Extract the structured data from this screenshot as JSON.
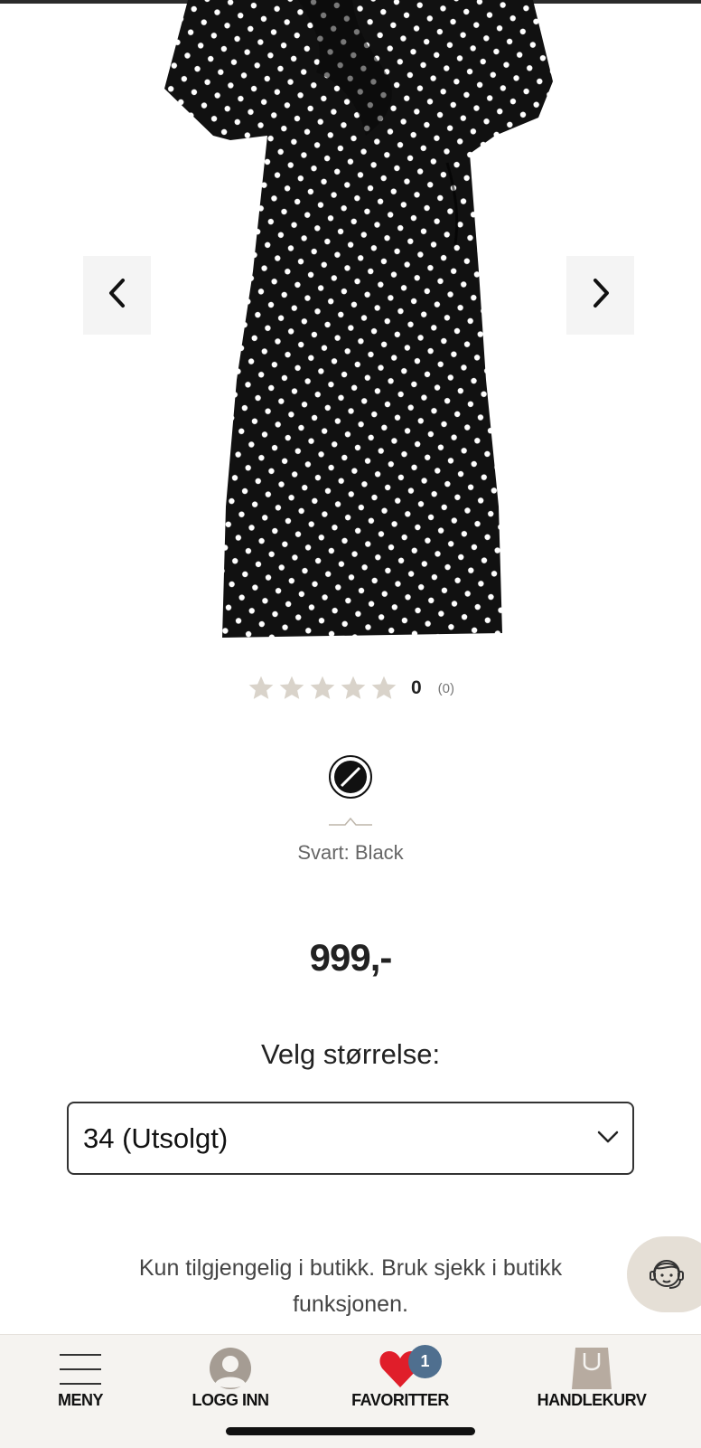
{
  "product": {
    "rating": {
      "stars_filled": 0,
      "stars_total": 5,
      "value": "0",
      "count": "(0)"
    },
    "color": {
      "label": "Svart: Black",
      "swatch_color": "#111111"
    },
    "price": "999,-"
  },
  "size": {
    "label": "Velg størrelse:",
    "selected": "34 (Utsolgt)"
  },
  "availability_text": "Kun tilgjengelig i butikk. Bruk sjekk i butikk funksjonen.",
  "bottom_nav": {
    "menu": "MENY",
    "login": "LOGG INN",
    "favorites": "FAVORITTER",
    "favorites_badge": "1",
    "cart": "HANDLEKURV"
  },
  "icons": {
    "prev": "chevron-left-icon",
    "next": "chevron-right-icon",
    "chat": "customer-service-icon",
    "menu": "hamburger-icon",
    "login": "user-icon",
    "favorites": "heart-icon",
    "cart": "shopping-bag-icon"
  },
  "colors": {
    "accent_red": "#e01e2a",
    "badge_blue": "#4f6f8f",
    "star_empty": "#d9d3ca",
    "chat_bg": "#e5dfd6"
  }
}
